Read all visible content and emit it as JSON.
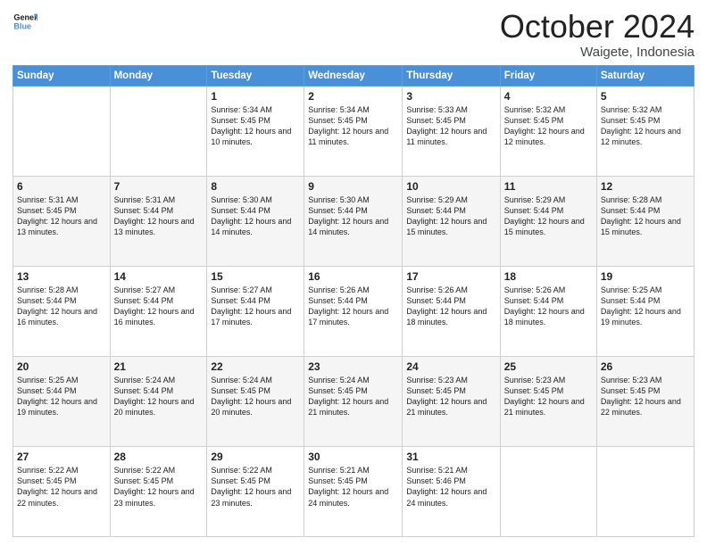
{
  "header": {
    "logo_general": "General",
    "logo_blue": "Blue",
    "month": "October 2024",
    "location": "Waigete, Indonesia"
  },
  "days_of_week": [
    "Sunday",
    "Monday",
    "Tuesday",
    "Wednesday",
    "Thursday",
    "Friday",
    "Saturday"
  ],
  "weeks": [
    [
      {
        "day": "",
        "sunrise": "",
        "sunset": "",
        "daylight": ""
      },
      {
        "day": "",
        "sunrise": "",
        "sunset": "",
        "daylight": ""
      },
      {
        "day": "1",
        "sunrise": "Sunrise: 5:34 AM",
        "sunset": "Sunset: 5:45 PM",
        "daylight": "Daylight: 12 hours and 10 minutes."
      },
      {
        "day": "2",
        "sunrise": "Sunrise: 5:34 AM",
        "sunset": "Sunset: 5:45 PM",
        "daylight": "Daylight: 12 hours and 11 minutes."
      },
      {
        "day": "3",
        "sunrise": "Sunrise: 5:33 AM",
        "sunset": "Sunset: 5:45 PM",
        "daylight": "Daylight: 12 hours and 11 minutes."
      },
      {
        "day": "4",
        "sunrise": "Sunrise: 5:32 AM",
        "sunset": "Sunset: 5:45 PM",
        "daylight": "Daylight: 12 hours and 12 minutes."
      },
      {
        "day": "5",
        "sunrise": "Sunrise: 5:32 AM",
        "sunset": "Sunset: 5:45 PM",
        "daylight": "Daylight: 12 hours and 12 minutes."
      }
    ],
    [
      {
        "day": "6",
        "sunrise": "Sunrise: 5:31 AM",
        "sunset": "Sunset: 5:45 PM",
        "daylight": "Daylight: 12 hours and 13 minutes."
      },
      {
        "day": "7",
        "sunrise": "Sunrise: 5:31 AM",
        "sunset": "Sunset: 5:44 PM",
        "daylight": "Daylight: 12 hours and 13 minutes."
      },
      {
        "day": "8",
        "sunrise": "Sunrise: 5:30 AM",
        "sunset": "Sunset: 5:44 PM",
        "daylight": "Daylight: 12 hours and 14 minutes."
      },
      {
        "day": "9",
        "sunrise": "Sunrise: 5:30 AM",
        "sunset": "Sunset: 5:44 PM",
        "daylight": "Daylight: 12 hours and 14 minutes."
      },
      {
        "day": "10",
        "sunrise": "Sunrise: 5:29 AM",
        "sunset": "Sunset: 5:44 PM",
        "daylight": "Daylight: 12 hours and 15 minutes."
      },
      {
        "day": "11",
        "sunrise": "Sunrise: 5:29 AM",
        "sunset": "Sunset: 5:44 PM",
        "daylight": "Daylight: 12 hours and 15 minutes."
      },
      {
        "day": "12",
        "sunrise": "Sunrise: 5:28 AM",
        "sunset": "Sunset: 5:44 PM",
        "daylight": "Daylight: 12 hours and 15 minutes."
      }
    ],
    [
      {
        "day": "13",
        "sunrise": "Sunrise: 5:28 AM",
        "sunset": "Sunset: 5:44 PM",
        "daylight": "Daylight: 12 hours and 16 minutes."
      },
      {
        "day": "14",
        "sunrise": "Sunrise: 5:27 AM",
        "sunset": "Sunset: 5:44 PM",
        "daylight": "Daylight: 12 hours and 16 minutes."
      },
      {
        "day": "15",
        "sunrise": "Sunrise: 5:27 AM",
        "sunset": "Sunset: 5:44 PM",
        "daylight": "Daylight: 12 hours and 17 minutes."
      },
      {
        "day": "16",
        "sunrise": "Sunrise: 5:26 AM",
        "sunset": "Sunset: 5:44 PM",
        "daylight": "Daylight: 12 hours and 17 minutes."
      },
      {
        "day": "17",
        "sunrise": "Sunrise: 5:26 AM",
        "sunset": "Sunset: 5:44 PM",
        "daylight": "Daylight: 12 hours and 18 minutes."
      },
      {
        "day": "18",
        "sunrise": "Sunrise: 5:26 AM",
        "sunset": "Sunset: 5:44 PM",
        "daylight": "Daylight: 12 hours and 18 minutes."
      },
      {
        "day": "19",
        "sunrise": "Sunrise: 5:25 AM",
        "sunset": "Sunset: 5:44 PM",
        "daylight": "Daylight: 12 hours and 19 minutes."
      }
    ],
    [
      {
        "day": "20",
        "sunrise": "Sunrise: 5:25 AM",
        "sunset": "Sunset: 5:44 PM",
        "daylight": "Daylight: 12 hours and 19 minutes."
      },
      {
        "day": "21",
        "sunrise": "Sunrise: 5:24 AM",
        "sunset": "Sunset: 5:44 PM",
        "daylight": "Daylight: 12 hours and 20 minutes."
      },
      {
        "day": "22",
        "sunrise": "Sunrise: 5:24 AM",
        "sunset": "Sunset: 5:45 PM",
        "daylight": "Daylight: 12 hours and 20 minutes."
      },
      {
        "day": "23",
        "sunrise": "Sunrise: 5:24 AM",
        "sunset": "Sunset: 5:45 PM",
        "daylight": "Daylight: 12 hours and 21 minutes."
      },
      {
        "day": "24",
        "sunrise": "Sunrise: 5:23 AM",
        "sunset": "Sunset: 5:45 PM",
        "daylight": "Daylight: 12 hours and 21 minutes."
      },
      {
        "day": "25",
        "sunrise": "Sunrise: 5:23 AM",
        "sunset": "Sunset: 5:45 PM",
        "daylight": "Daylight: 12 hours and 21 minutes."
      },
      {
        "day": "26",
        "sunrise": "Sunrise: 5:23 AM",
        "sunset": "Sunset: 5:45 PM",
        "daylight": "Daylight: 12 hours and 22 minutes."
      }
    ],
    [
      {
        "day": "27",
        "sunrise": "Sunrise: 5:22 AM",
        "sunset": "Sunset: 5:45 PM",
        "daylight": "Daylight: 12 hours and 22 minutes."
      },
      {
        "day": "28",
        "sunrise": "Sunrise: 5:22 AM",
        "sunset": "Sunset: 5:45 PM",
        "daylight": "Daylight: 12 hours and 23 minutes."
      },
      {
        "day": "29",
        "sunrise": "Sunrise: 5:22 AM",
        "sunset": "Sunset: 5:45 PM",
        "daylight": "Daylight: 12 hours and 23 minutes."
      },
      {
        "day": "30",
        "sunrise": "Sunrise: 5:21 AM",
        "sunset": "Sunset: 5:45 PM",
        "daylight": "Daylight: 12 hours and 24 minutes."
      },
      {
        "day": "31",
        "sunrise": "Sunrise: 5:21 AM",
        "sunset": "Sunset: 5:46 PM",
        "daylight": "Daylight: 12 hours and 24 minutes."
      },
      {
        "day": "",
        "sunrise": "",
        "sunset": "",
        "daylight": ""
      },
      {
        "day": "",
        "sunrise": "",
        "sunset": "",
        "daylight": ""
      }
    ]
  ]
}
